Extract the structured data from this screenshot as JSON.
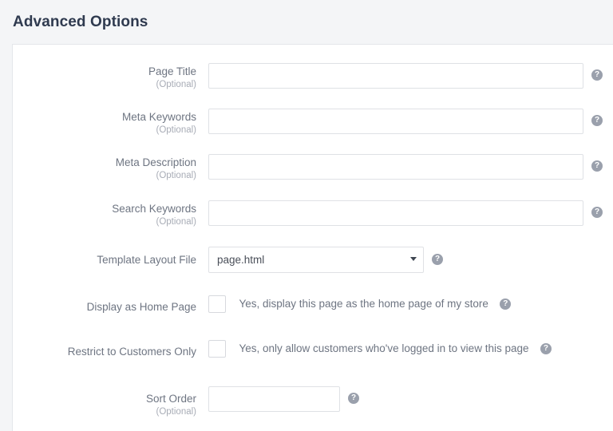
{
  "page": {
    "heading": "Advanced Options"
  },
  "optional_text": "(Optional)",
  "help_glyph": "?",
  "fields": {
    "page_title": {
      "label": "Page Title",
      "optional": "(Optional)",
      "value": "",
      "placeholder": ""
    },
    "meta_keywords": {
      "label": "Meta Keywords",
      "optional": "(Optional)",
      "value": "",
      "placeholder": ""
    },
    "meta_description": {
      "label": "Meta Description",
      "optional": "(Optional)",
      "value": "",
      "placeholder": ""
    },
    "search_keywords": {
      "label": "Search Keywords",
      "optional": "(Optional)",
      "value": "",
      "placeholder": ""
    },
    "template_layout_file": {
      "label": "Template Layout File",
      "selected": "page.html",
      "options": [
        "page.html"
      ]
    },
    "display_as_home_page": {
      "label": "Display as Home Page",
      "checkbox_label": "Yes, display this page as the home page of my store",
      "checked": false
    },
    "restrict_to_customers_only": {
      "label": "Restrict to Customers Only",
      "checkbox_label": "Yes, only allow customers who've logged in to view this page",
      "checked": false
    },
    "sort_order": {
      "label": "Sort Order",
      "optional": "(Optional)",
      "value": "",
      "placeholder": ""
    }
  },
  "colors": {
    "page_background": "#f4f5f7",
    "panel_background": "#ffffff",
    "heading_text": "#2f3a4f",
    "label_text": "#6e7582",
    "optional_text": "#a8acb6",
    "input_border": "#dfe1e5",
    "help_icon": "#9aa0ac"
  }
}
